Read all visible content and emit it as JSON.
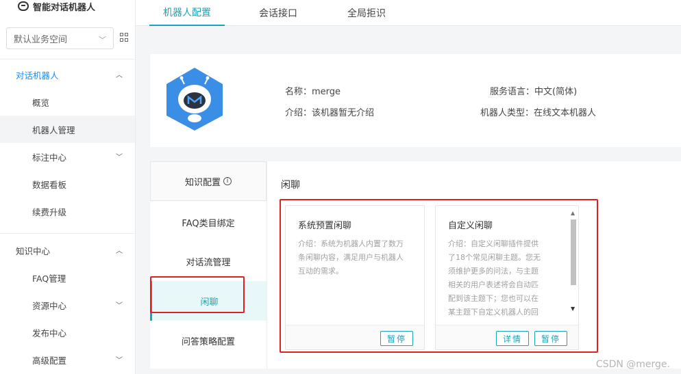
{
  "app": {
    "title": "智能对话机器人"
  },
  "workspace": {
    "label": "默认业务空间"
  },
  "sidebar": {
    "groups": [
      {
        "label": "对话机器人",
        "items": [
          "概览",
          "机器人管理",
          "标注中心",
          "数据看板",
          "续费升级"
        ]
      },
      {
        "label": "知识中心",
        "items": [
          "FAQ管理",
          "资源中心",
          "发布中心",
          "高级配置"
        ]
      }
    ]
  },
  "tabs": [
    "机器人配置",
    "会话接口",
    "全局拒识"
  ],
  "profile": {
    "name_label": "名称：",
    "name_value": "merge",
    "intro_label": "介绍：",
    "intro_value": "该机器暂无介绍",
    "lang_label": "服务语言：",
    "lang_value": "中文(简体)",
    "type_label": "机器人类型：",
    "type_value": "在线文本机器人"
  },
  "left_menu": {
    "header": "知识配置",
    "items": [
      "FAQ类目绑定",
      "对话流管理",
      "闲聊",
      "问答策略配置"
    ]
  },
  "panel": {
    "title": "闲聊",
    "cards": [
      {
        "title": "系统预置闲聊",
        "desc_lines": [
          "介绍：系统为机器人内置了数万",
          "条闲聊内容，满足用户与机器人",
          "互动的需求。"
        ],
        "buttons": [
          "暂停"
        ]
      },
      {
        "title": "自定义闲聊",
        "desc_lines": [
          "介绍：自定义闲聊插件提供",
          "了18个常见闲聊主题。您无",
          "须维护更多的问法，与主题",
          "相关的用户表述将会自动匹",
          "配到该主题下；您也可以在",
          "某主题下自定义机器人的回"
        ],
        "buttons": [
          "详情",
          "暂停"
        ]
      }
    ]
  },
  "watermark": "CSDN @merge."
}
